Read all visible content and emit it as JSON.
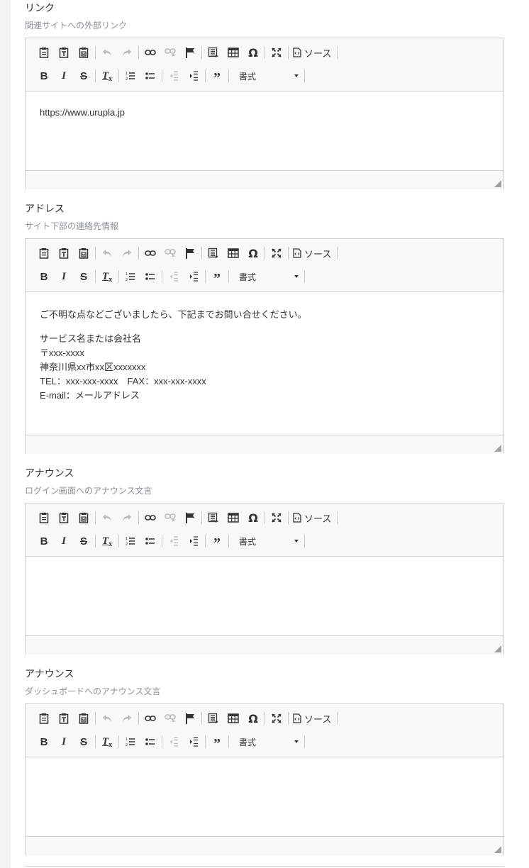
{
  "toolbar": {
    "source_label": "ソース",
    "format_label": "書式",
    "icons_row1": [
      "paste-icon",
      "paste-text-icon",
      "paste-word-icon",
      "undo-icon",
      "redo-icon",
      "link-icon",
      "unlink-icon",
      "anchor-icon",
      "showblocks-icon",
      "table-icon",
      "special-char-icon",
      "maximize-icon",
      "source-icon"
    ],
    "icons_row2": [
      "bold-icon",
      "italic-icon",
      "strike-icon",
      "remove-format-icon",
      "numbered-list-icon",
      "bulleted-list-icon",
      "outdent-icon",
      "indent-icon",
      "blockquote-icon",
      "format-combo"
    ]
  },
  "fields": [
    {
      "label": "リンク",
      "description": "関連サイトへの外部リンク",
      "content": [
        "https://www.urupla.jp"
      ]
    },
    {
      "label": "アドレス",
      "description": "サイト下部の連絡先情報",
      "content": [
        "ご不明な点などございましたら、下記までお問い合せください。",
        "サービス名または会社名",
        "〒xxx-xxxx",
        "神奈川県xx市xx区xxxxxxx",
        "TEL：xxx-xxx-xxxx　FAX：xxx-xxx-xxxx",
        "E-mail：メールアドレス"
      ]
    },
    {
      "label": "アナウンス",
      "description": "ログイン画面へのアナウンス文言",
      "content": []
    },
    {
      "label": "アナウンス",
      "description": "ダッシュボードへのアナウンス文言",
      "content": []
    }
  ]
}
